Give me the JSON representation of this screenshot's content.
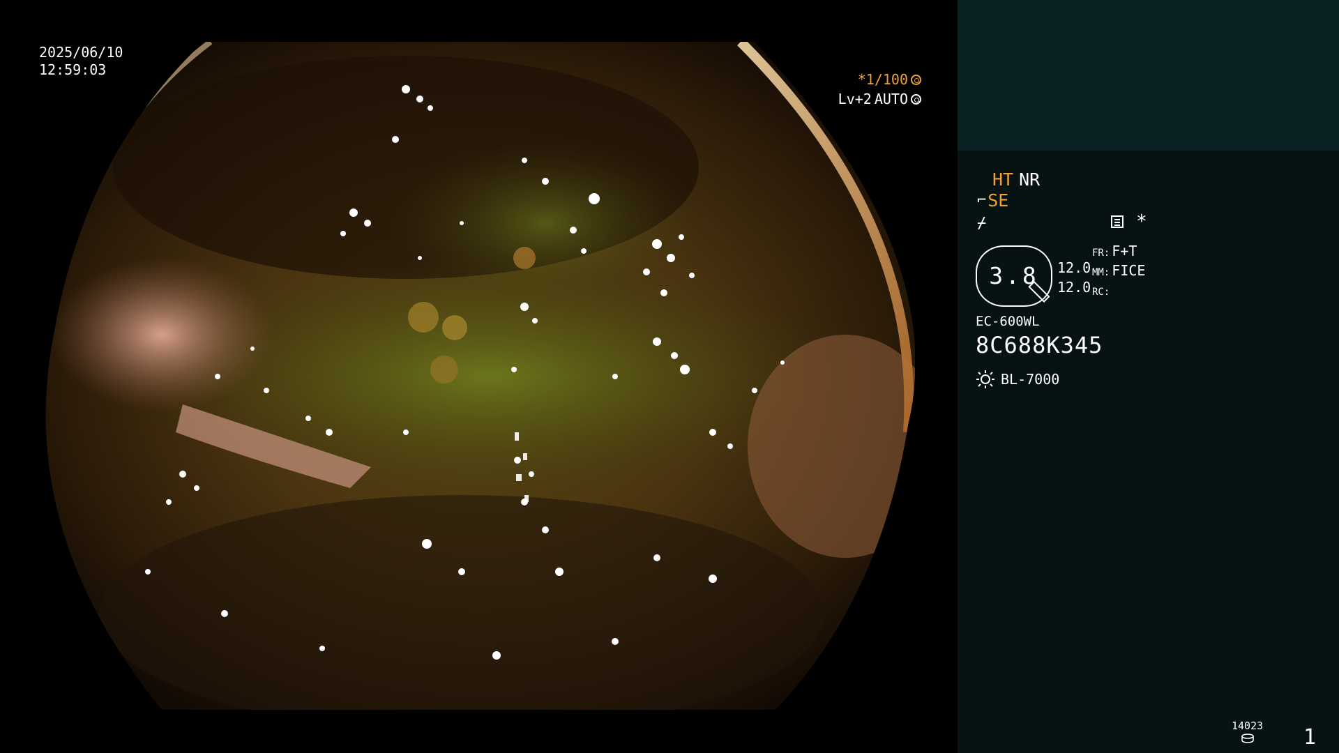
{
  "image": {
    "date": "2025/06/10",
    "time": "12:59:03"
  },
  "shutter": {
    "speed": "*1/100",
    "level": "Lv+2",
    "mode": "AUTO",
    "shutter_icon": "aperture-icon",
    "auto_icon": "iris-icon"
  },
  "panel": {
    "ht_label": "HT",
    "nr_label": "NR",
    "se_label": "SE",
    "star_label": "*",
    "zoom_value": "3.8",
    "value_1": "12.0",
    "value_2": "12.0",
    "fr_label": "FR:",
    "fr_value": "F+T",
    "mm_label": "MM:",
    "mm_value": "FICE",
    "rc_label": "RC:",
    "rc_value": "",
    "scope_model": "EC-600WL",
    "scope_serial": "8C688K345",
    "light_source": "BL-7000",
    "image_count": "14023",
    "page_number": "1"
  },
  "colors": {
    "accent": "#f0a23a",
    "panel_bg": "#071212",
    "panel_top_bg": "#0b2224"
  }
}
